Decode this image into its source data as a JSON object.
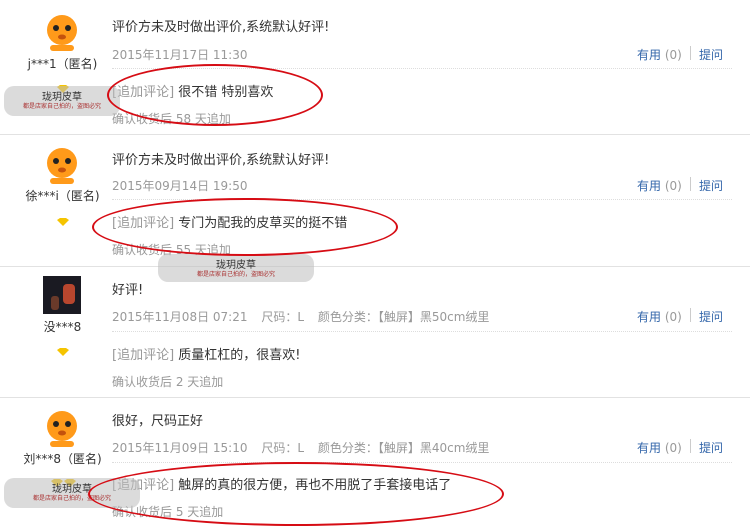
{
  "reviews": [
    {
      "username": "j***1（匿名)",
      "content": "评价方未及时做出评价,系统默认好评!",
      "datetime": "2015年11月17日 11:30",
      "size": "",
      "color": "",
      "append_tag": "[追加评论]",
      "append_text": "很不错 特别喜欢",
      "append_when": "确认收货后 58 天追加",
      "useful_label": "有用",
      "useful_count": "(0)",
      "ask_label": "提问",
      "avatar": "orange-mascot-icon"
    },
    {
      "username": "徐***i（匿名)",
      "content": "评价方未及时做出评价,系统默认好评!",
      "datetime": "2015年09月14日 19:50",
      "size": "",
      "color": "",
      "append_tag": "[追加评论]",
      "append_text": "专门为配我的皮草买的挺不错",
      "append_when": "确认收货后 55 天追加",
      "useful_label": "有用",
      "useful_count": "(0)",
      "ask_label": "提问",
      "avatar": "orange-mascot-icon"
    },
    {
      "username": "没***8",
      "content": "好评!",
      "datetime": "2015年11月08日 07:21",
      "size": "尺码：L",
      "color": "颜色分类：【触屏】黑50cm绒里",
      "append_tag": "[追加评论]",
      "append_text": "质量杠杠的，很喜欢!",
      "append_when": "确认收货后 2 天追加",
      "useful_label": "有用",
      "useful_count": "(0)",
      "ask_label": "提问",
      "avatar": "user-photo"
    },
    {
      "username": "刘***8（匿名)",
      "content": "很好，尺码正好",
      "datetime": "2015年11月09日 15:10",
      "size": "尺码：L",
      "color": "颜色分类：【触屏】黑40cm绒里",
      "append_tag": "[追加评论]",
      "append_text": "触屏的真的很方便，再也不用脱了手套接电话了",
      "append_when": "确认收货后 5 天追加",
      "useful_label": "有用",
      "useful_count": "(0)",
      "ask_label": "提问",
      "avatar": "orange-mascot-icon"
    }
  ],
  "watermark": {
    "title": "珑玥皮草",
    "subtitle": "都是店家自己拍的，盗图必究"
  },
  "colors": {
    "link": "#3366aa",
    "muted": "#999999",
    "highlight_oval": "#d60c14",
    "badge": "#f5c400",
    "mascot": "#ff9a1a"
  }
}
